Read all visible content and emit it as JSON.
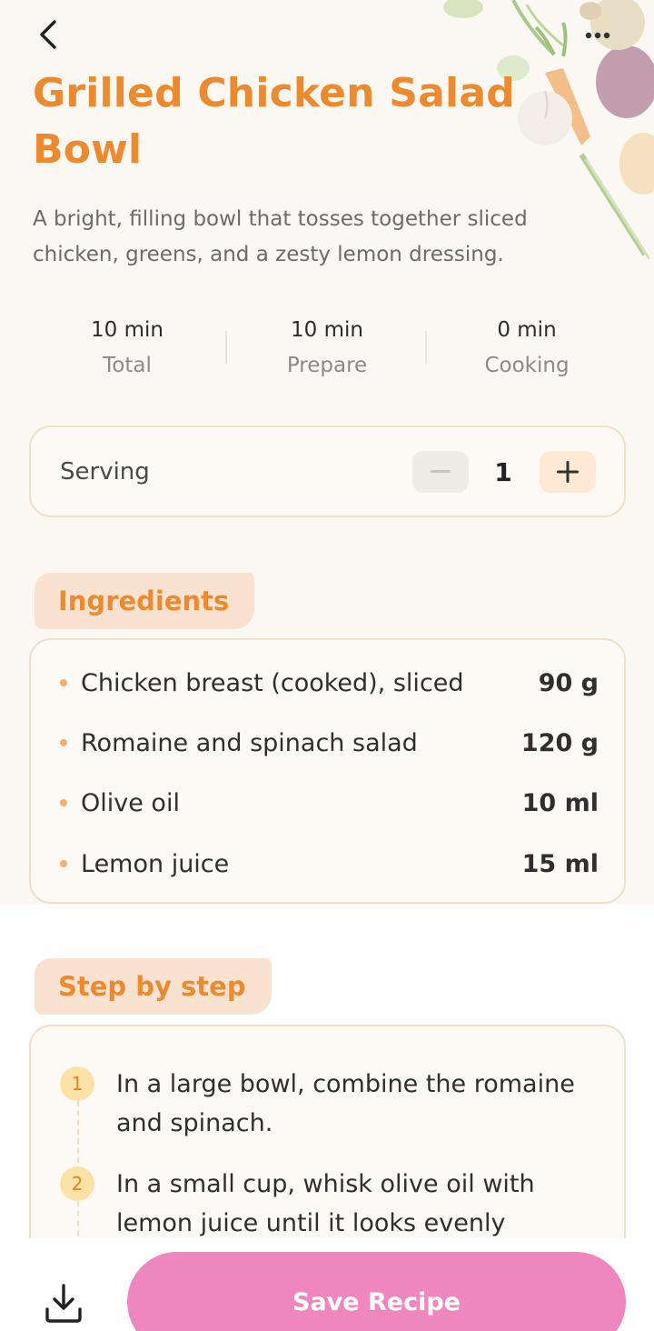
{
  "header": {
    "back_icon": "chevron-left-icon",
    "more_icon": "more-horizontal-icon"
  },
  "recipe": {
    "title": "Grilled Chicken Salad Bowl",
    "description": "A bright, filling bowl that tosses together sliced chicken, greens, and a zesty lemon dressing."
  },
  "stats": [
    {
      "value": "10 min",
      "label": "Total"
    },
    {
      "value": "10 min",
      "label": "Prepare"
    },
    {
      "value": "0 min",
      "label": "Cooking"
    }
  ],
  "serving": {
    "label": "Serving",
    "count": "1",
    "minus": "−",
    "plus": "+"
  },
  "ingredients": {
    "heading": "Ingredients",
    "items": [
      {
        "name": "Chicken breast (cooked), sliced",
        "amount": "90 g"
      },
      {
        "name": "Romaine and spinach salad",
        "amount": "120 g"
      },
      {
        "name": "Olive oil",
        "amount": "10 ml"
      },
      {
        "name": "Lemon juice",
        "amount": "15 ml"
      }
    ]
  },
  "steps": {
    "heading": "Step by step",
    "items": [
      {
        "num": "1",
        "text": "In a large bowl, combine the romaine and spinach."
      },
      {
        "num": "2",
        "text": "In a small cup, whisk olive oil with lemon juice until it looks evenly"
      }
    ]
  },
  "footer": {
    "download_icon": "download-icon",
    "save_label": "Save Recipe"
  },
  "colors": {
    "accent": "#ec8a2f",
    "save_button": "#ef86bf",
    "section_highlight": "#f9e3d0",
    "card_border": "#efe0c9"
  }
}
